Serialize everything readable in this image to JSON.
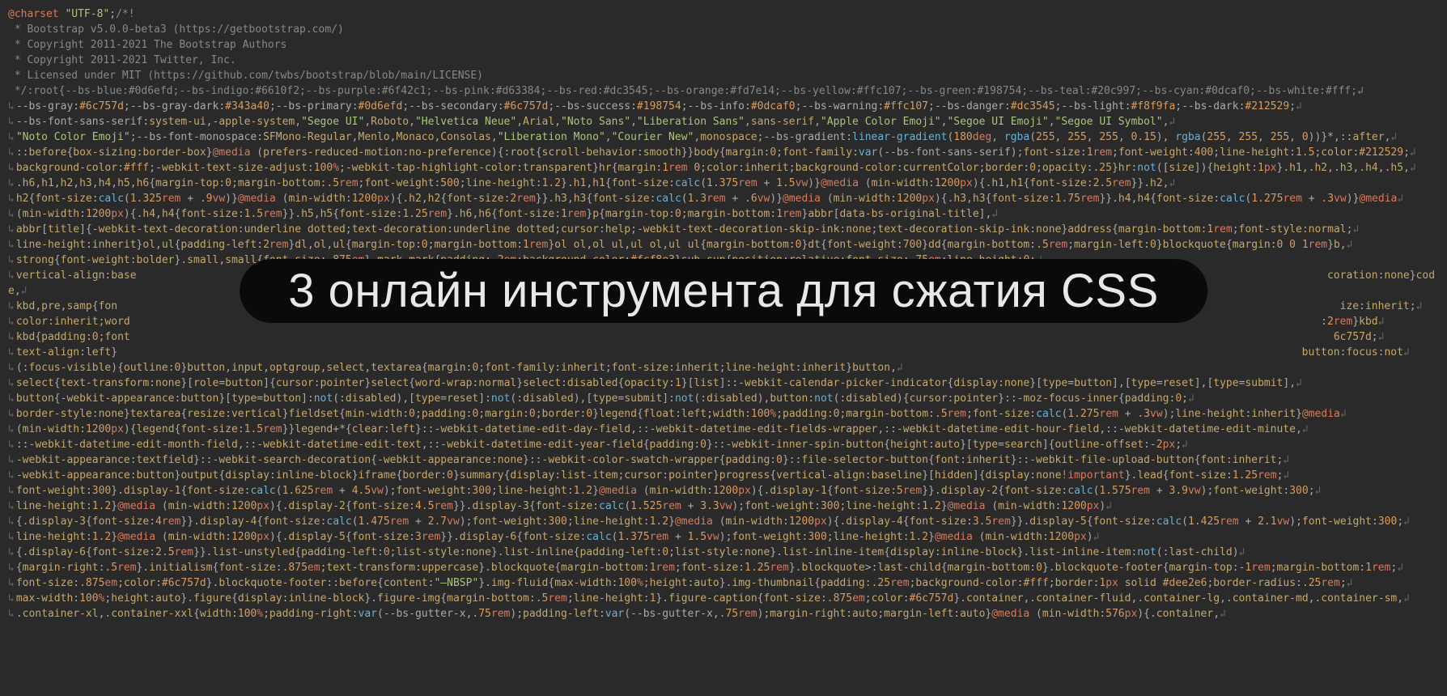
{
  "banner": {
    "text": "3 онлайн инструмента для сжатия CSS"
  },
  "code_lines": [
    "@charset \"UTF-8\";/*!",
    " * Bootstrap v5.0.0-beta3 (https://getbootstrap.com/)",
    " * Copyright 2011-2021 The Bootstrap Authors",
    " * Copyright 2011-2021 Twitter, Inc.",
    " * Licensed under MIT (https://github.com/twbs/bootstrap/blob/main/LICENSE)",
    " */:root{--bs-blue:#0d6efd;--bs-indigo:#6610f2;--bs-purple:#6f42c1;--bs-pink:#d63384;--bs-red:#dc3545;--bs-orange:#fd7e14;--bs-yellow:#ffc107;--bs-green:#198754;--bs-teal:#20c997;--bs-cyan:#0dcaf0;--bs-white:#fff;↲",
    "↳--bs-gray:#6c757d;--bs-gray-dark:#343a40;--bs-primary:#0d6efd;--bs-secondary:#6c757d;--bs-success:#198754;--bs-info:#0dcaf0;--bs-warning:#ffc107;--bs-danger:#dc3545;--bs-light:#f8f9fa;--bs-dark:#212529;↲",
    "↳--bs-font-sans-serif:system-ui,-apple-system,\"Segoe UI\",Roboto,\"Helvetica Neue\",Arial,\"Noto Sans\",\"Liberation Sans\",sans-serif,\"Apple Color Emoji\",\"Segoe UI Emoji\",\"Segoe UI Symbol\",↲",
    "↳\"Noto Color Emoji\";--bs-font-monospace:SFMono-Regular,Menlo,Monaco,Consolas,\"Liberation Mono\",\"Courier New\",monospace;--bs-gradient:linear-gradient(180deg, rgba(255, 255, 255, 0.15), rgba(255, 255, 255, 0))}*,::after,↲",
    "↳::before{box-sizing:border-box}@media (prefers-reduced-motion:no-preference){:root{scroll-behavior:smooth}}body{margin:0;font-family:var(--bs-font-sans-serif);font-size:1rem;font-weight:400;line-height:1.5;color:#212529;↲",
    "↳background-color:#fff;-webkit-text-size-adjust:100%;-webkit-tap-highlight-color:transparent}hr{margin:1rem 0;color:inherit;background-color:currentColor;border:0;opacity:.25}hr:not([size]){height:1px}.h1,.h2,.h3,.h4,.h5,↲",
    "↳.h6,h1,h2,h3,h4,h5,h6{margin-top:0;margin-bottom:.5rem;font-weight:500;line-height:1.2}.h1,h1{font-size:calc(1.375rem + 1.5vw)}@media (min-width:1200px){.h1,h1{font-size:2.5rem}}.h2,↲",
    "↳h2{font-size:calc(1.325rem + .9vw)}@media (min-width:1200px){.h2,h2{font-size:2rem}}.h3,h3{font-size:calc(1.3rem + .6vw)}@media (min-width:1200px){.h3,h3{font-size:1.75rem}}.h4,h4{font-size:calc(1.275rem + .3vw)}@media↲",
    "↳(min-width:1200px){.h4,h4{font-size:1.5rem}}.h5,h5{font-size:1.25rem}.h6,h6{font-size:1rem}p{margin-top:0;margin-bottom:1rem}abbr[data-bs-original-title],↲",
    "↳abbr[title]{-webkit-text-decoration:underline dotted;text-decoration:underline dotted;cursor:help;-webkit-text-decoration-skip-ink:none;text-decoration-skip-ink:none}address{margin-bottom:1rem;font-style:normal;↲",
    "↳line-height:inherit}ol,ul{padding-left:2rem}dl,ol,ul{margin-top:0;margin-bottom:1rem}ol ol,ol ul,ul ol,ul ul{margin-bottom:0}dt{font-weight:700}dd{margin-bottom:.5rem;margin-left:0}blockquote{margin:0 0 1rem}b,↲",
    "↳strong{font-weight:bolder}.small,small{font-size:.875em}.mark,mark{padding:.2em;background-color:#fcf8e3}sub,sup{position:relative;font-size:.75em;line-height:0;↲",
    "↳vertical-align:base                                                                                                                                                                                            coration:none}code,↲",
    "↳kbd,pre,samp{fon                                                                                                                                                                                                 ize:inherit;↲",
    "↳color:inherit;word                                                                                                                                                                                            :2rem}kbd↲",
    "↳kbd{padding:0;font                                                                                                                                                                                              6c757d;↲",
    "↳text-align:left}                                                                                                                                                                                           button:focus:not↲",
    "↳(:focus-visible){outline:0}button,input,optgroup,select,textarea{margin:0;font-family:inherit;font-size:inherit;line-height:inherit}button,↲",
    "↳select{text-transform:none}[role=button]{cursor:pointer}select{word-wrap:normal}select:disabled{opacity:1}[list]::-webkit-calendar-picker-indicator{display:none}[type=button],[type=reset],[type=submit],↲",
    "↳button{-webkit-appearance:button}[type=button]:not(:disabled),[type=reset]:not(:disabled),[type=submit]:not(:disabled),button:not(:disabled){cursor:pointer}::-moz-focus-inner{padding:0;↲",
    "↳border-style:none}textarea{resize:vertical}fieldset{min-width:0;padding:0;margin:0;border:0}legend{float:left;width:100%;padding:0;margin-bottom:.5rem;font-size:calc(1.275rem + .3vw);line-height:inherit}@media↲",
    "↳(min-width:1200px){legend{font-size:1.5rem}}legend+*{clear:left}::-webkit-datetime-edit-day-field,::-webkit-datetime-edit-fields-wrapper,::-webkit-datetime-edit-hour-field,::-webkit-datetime-edit-minute,↲",
    "↳::-webkit-datetime-edit-month-field,::-webkit-datetime-edit-text,::-webkit-datetime-edit-year-field{padding:0}::-webkit-inner-spin-button{height:auto}[type=search]{outline-offset:-2px;↲",
    "↳-webkit-appearance:textfield}::-webkit-search-decoration{-webkit-appearance:none}::-webkit-color-swatch-wrapper{padding:0}::file-selector-button{font:inherit}::-webkit-file-upload-button{font:inherit;↲",
    "↳-webkit-appearance:button}output{display:inline-block}iframe{border:0}summary{display:list-item;cursor:pointer}progress{vertical-align:baseline}[hidden]{display:none!important}.lead{font-size:1.25rem;↲",
    "↳font-weight:300}.display-1{font-size:calc(1.625rem + 4.5vw);font-weight:300;line-height:1.2}@media (min-width:1200px){.display-1{font-size:5rem}}.display-2{font-size:calc(1.575rem + 3.9vw);font-weight:300;↲",
    "↳line-height:1.2}@media (min-width:1200px){.display-2{font-size:4.5rem}}.display-3{font-size:calc(1.525rem + 3.3vw);font-weight:300;line-height:1.2}@media (min-width:1200px)↲",
    "↳{.display-3{font-size:4rem}}.display-4{font-size:calc(1.475rem + 2.7vw);font-weight:300;line-height:1.2}@media (min-width:1200px){.display-4{font-size:3.5rem}}.display-5{font-size:calc(1.425rem + 2.1vw);font-weight:300;↲",
    "↳line-height:1.2}@media (min-width:1200px){.display-5{font-size:3rem}}.display-6{font-size:calc(1.375rem + 1.5vw);font-weight:300;line-height:1.2}@media (min-width:1200px)↲",
    "↳{.display-6{font-size:2.5rem}}.list-unstyled{padding-left:0;list-style:none}.list-inline{padding-left:0;list-style:none}.list-inline-item{display:inline-block}.list-inline-item:not(:last-child)↲",
    "↳{margin-right:.5rem}.initialism{font-size:.875em;text-transform:uppercase}.blockquote{margin-bottom:1rem;font-size:1.25rem}.blockquote>:last-child{margin-bottom:0}.blockquote-footer{margin-top:-1rem;margin-bottom:1rem;↲",
    "↳font-size:.875em;color:#6c757d}.blockquote-footer::before{content:\"—NBSP\"}.img-fluid{max-width:100%;height:auto}.img-thumbnail{padding:.25rem;background-color:#fff;border:1px solid #dee2e6;border-radius:.25rem;↲",
    "↳max-width:100%;height:auto}.figure{display:inline-block}.figure-img{margin-bottom:.5rem;line-height:1}.figure-caption{font-size:.875em;color:#6c757d}.container,.container-fluid,.container-lg,.container-md,.container-sm,↲",
    "↳.container-xl,.container-xxl{width:100%;padding-right:var(--bs-gutter-x,.75rem);padding-left:var(--bs-gutter-x,.75rem);margin-right:auto;margin-left:auto}@media (min-width:576px){.container,↲"
  ]
}
